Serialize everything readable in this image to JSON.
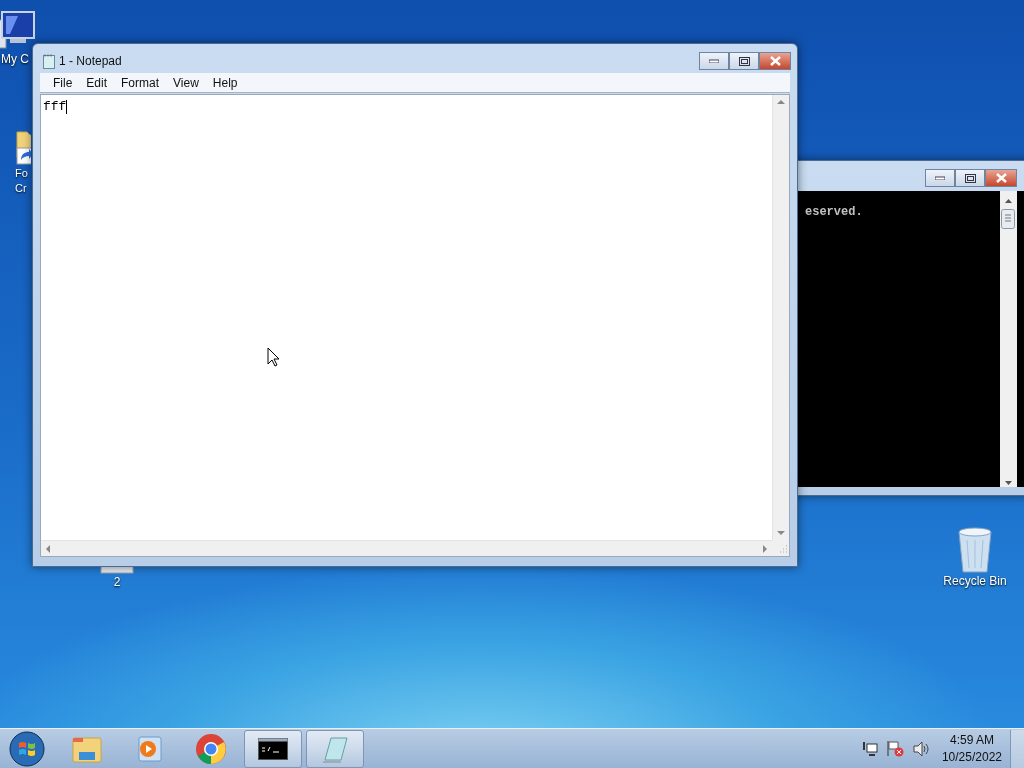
{
  "desktop_icons": [
    {
      "kind": "computer",
      "lines": [
        "My C"
      ]
    },
    {
      "kind": "shortcut",
      "lines": [
        "Fo",
        "Cr"
      ]
    },
    {
      "kind": "file",
      "lines": [
        "2"
      ]
    },
    {
      "kind": "recycle",
      "lines": [
        "Recycle Bin"
      ]
    }
  ],
  "console_window": {
    "lines": [
      "eserved."
    ]
  },
  "notepad": {
    "title": "1 - Notepad",
    "menu": [
      "File",
      "Edit",
      "Format",
      "View",
      "Help"
    ],
    "text": "fff"
  },
  "taskbar": {
    "items": [
      {
        "kind": "explorer",
        "running": false
      },
      {
        "kind": "media",
        "running": false
      },
      {
        "kind": "chrome",
        "running": false
      },
      {
        "kind": "console",
        "running": true
      },
      {
        "kind": "notepad",
        "running": true
      }
    ],
    "time": "4:59 AM",
    "date": "10/25/2022"
  }
}
